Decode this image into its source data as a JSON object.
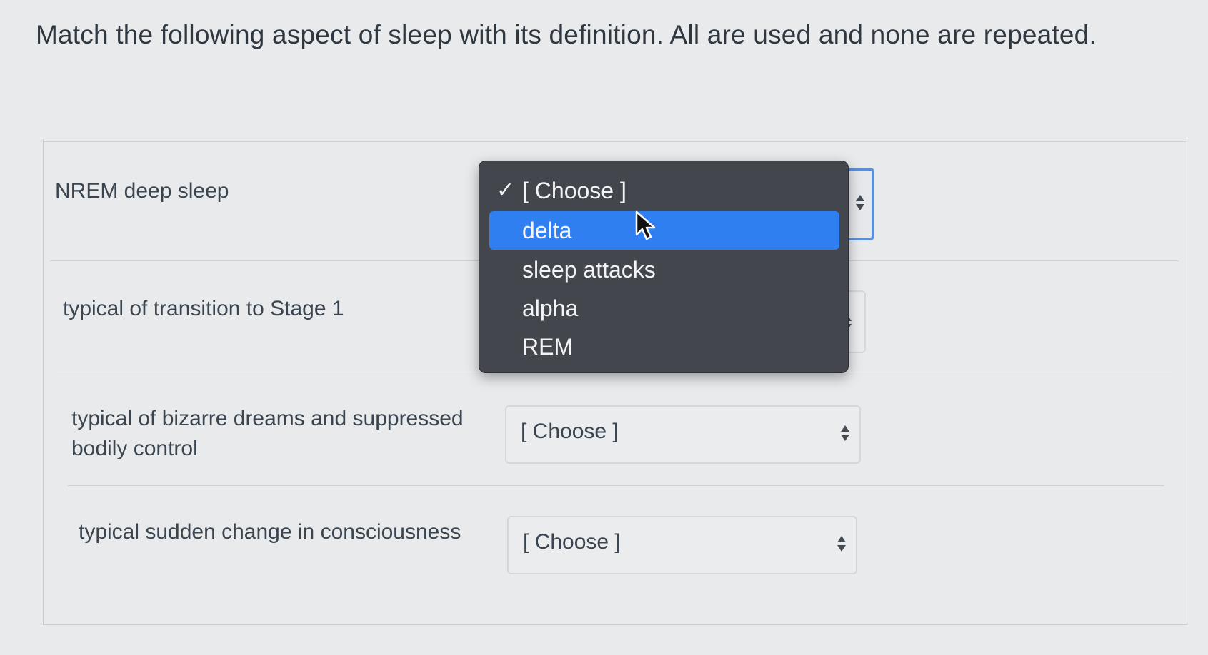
{
  "question": {
    "text": "Match the following aspect of sleep with its definition. All are used and none are repeated."
  },
  "rows": [
    {
      "prompt": "NREM deep sleep",
      "selected": "[ Choose ]"
    },
    {
      "prompt": "typical of transition to Stage 1",
      "selected": "[ Choose ]"
    },
    {
      "prompt": "typical of bizarre dreams and suppressed bodily control",
      "selected": "[ Choose ]"
    },
    {
      "prompt": "typical sudden change in consciousness",
      "selected": "[ Choose ]"
    }
  ],
  "dropdown": {
    "options": [
      {
        "label": "[ Choose ]",
        "checked": true
      },
      {
        "label": "delta",
        "highlighted": true
      },
      {
        "label": "sleep attacks"
      },
      {
        "label": "alpha"
      },
      {
        "label": "REM"
      }
    ]
  },
  "colors": {
    "highlight": "#2f7ff0",
    "dropdown_bg": "#43474d",
    "focus_ring": "#5b8fd6"
  }
}
